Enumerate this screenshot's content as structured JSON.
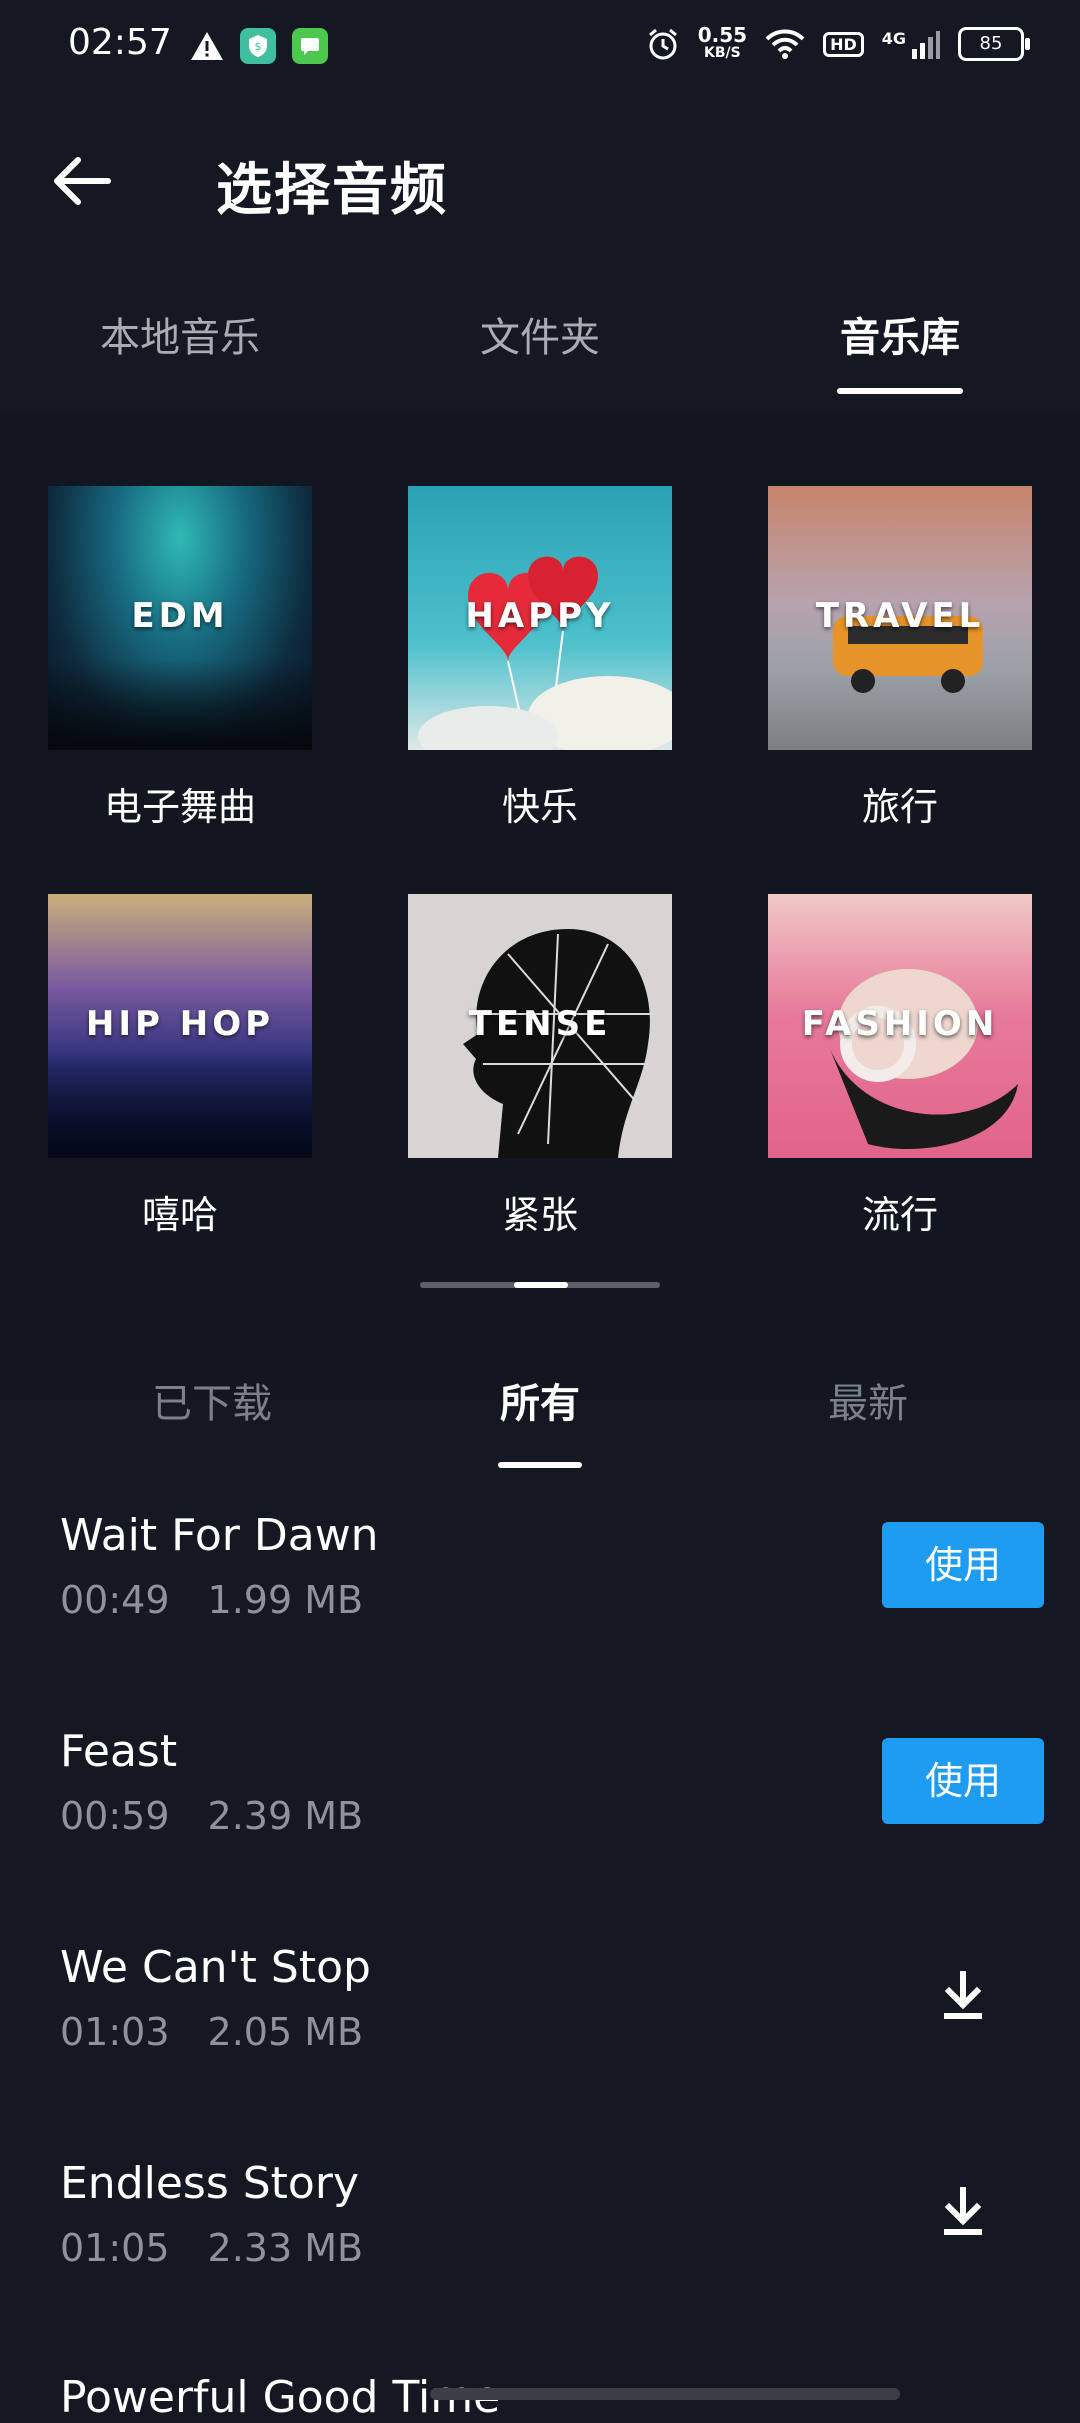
{
  "status_bar": {
    "time": "02:57",
    "speed_value": "0.55",
    "speed_unit": "KB/S",
    "hd_label": "HD",
    "network_label": "4G",
    "battery": "85",
    "icons": [
      "warning-icon",
      "shield-app-icon",
      "message-app-icon",
      "alarm-icon",
      "wifi-icon",
      "signal-icon"
    ]
  },
  "header": {
    "title": "选择音频",
    "back_icon": "back-arrow-icon"
  },
  "top_tabs": [
    {
      "label": "本地音乐",
      "active": false
    },
    {
      "label": "文件夹",
      "active": false
    },
    {
      "label": "音乐库",
      "active": true
    }
  ],
  "categories": [
    {
      "name": "电子舞曲",
      "cover_text": "EDM"
    },
    {
      "name": "快乐",
      "cover_text": "HAPPY"
    },
    {
      "name": "旅行",
      "cover_text": "TRAVEL"
    },
    {
      "name": "嘻哈",
      "cover_text": "HIP HOP"
    },
    {
      "name": "紧张",
      "cover_text": "TENSE"
    },
    {
      "name": "流行",
      "cover_text": "FASHION"
    }
  ],
  "sub_tabs": [
    {
      "label": "已下载",
      "active": false
    },
    {
      "label": "所有",
      "active": true
    },
    {
      "label": "最新",
      "active": false
    }
  ],
  "tracks": [
    {
      "title": "Wait For Dawn",
      "duration": "00:49",
      "size": "1.99 MB",
      "action": "use",
      "action_label": "使用"
    },
    {
      "title": "Feast",
      "duration": "00:59",
      "size": "2.39 MB",
      "action": "use",
      "action_label": "使用"
    },
    {
      "title": "We Can't Stop",
      "duration": "01:03",
      "size": "2.05 MB",
      "action": "download",
      "action_icon": "download-icon"
    },
    {
      "title": "Endless Story",
      "duration": "01:05",
      "size": "2.33 MB",
      "action": "download",
      "action_icon": "download-icon"
    }
  ],
  "partial_track_title": "Powerful Good Time",
  "colors": {
    "background": "#131822",
    "content_background": "#111620",
    "accent": "#1e9cf2",
    "muted_text": "#8e929b"
  }
}
